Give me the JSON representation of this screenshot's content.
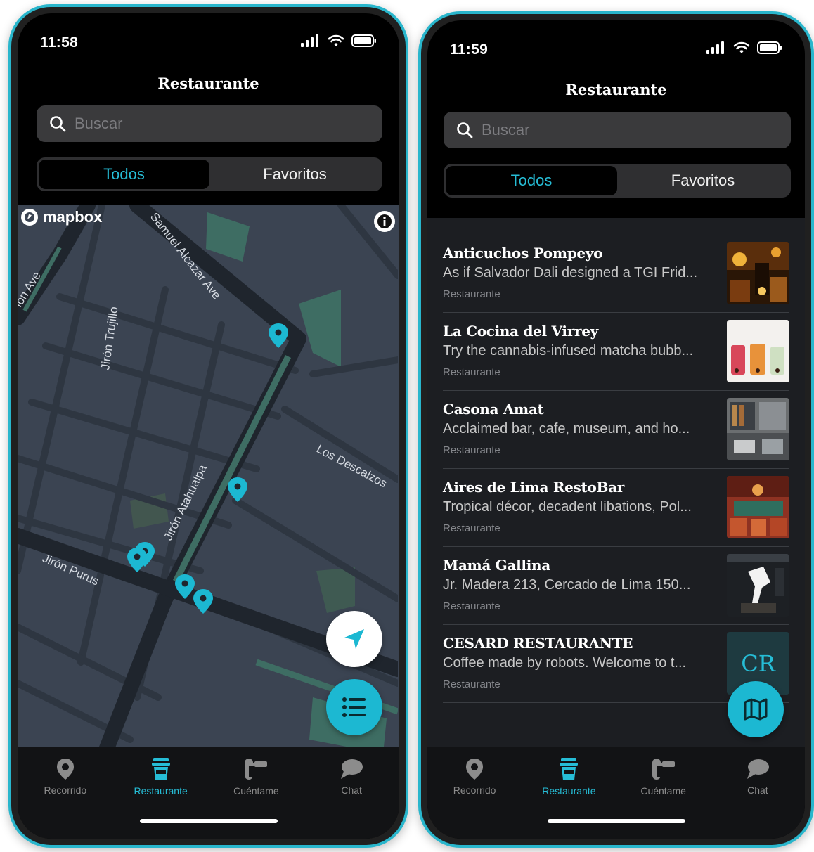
{
  "accent_color": "#26bdd6",
  "screen1": {
    "status": {
      "time": "11:58"
    },
    "title": "Restaurante",
    "search": {
      "placeholder": "Buscar",
      "icon": "search-icon"
    },
    "segments": {
      "all": "Todos",
      "favorites": "Favoritos"
    },
    "map": {
      "logo": "mapbox",
      "streets": [
        "Samuel Alcazar Ave",
        "Jirón Trujillo",
        "Jirón Atahualpa",
        "Los Descalzos",
        "Jirón Purus",
        "ion Ave"
      ]
    }
  },
  "screen2": {
    "status": {
      "time": "11:59"
    },
    "title": "Restaurante",
    "search": {
      "placeholder": "Buscar",
      "icon": "search-icon"
    },
    "segments": {
      "all": "Todos",
      "favorites": "Favoritos"
    },
    "list": [
      {
        "name": "Anticuchos Pompeyo",
        "desc": "As if Salvador Dali designed a TGI Frid...",
        "category": "Restaurante"
      },
      {
        "name": "La Cocina del Virrey",
        "desc": "Try the cannabis-infused matcha bubb...",
        "category": "Restaurante"
      },
      {
        "name": "Casona Amat",
        "desc": "Acclaimed bar, cafe, museum, and ho...",
        "category": "Restaurante"
      },
      {
        "name": "Aires de Lima RestoBar",
        "desc": "Tropical décor, decadent libations, Pol...",
        "category": "Restaurante"
      },
      {
        "name": "Mamá Gallina",
        "desc": "Jr. Madera 213, Cercado de Lima 150...",
        "category": "Restaurante"
      },
      {
        "name": "CESARD RESTAURANTE",
        "desc": "Coffee made by robots. Welcome to t...",
        "category": "Restaurante",
        "thumb_text": "CR"
      }
    ]
  },
  "tabbar": [
    {
      "label": "Recorrido",
      "icon": "location-pin-icon"
    },
    {
      "label": "Restaurante",
      "icon": "coffee-cup-icon"
    },
    {
      "label": "Cuéntame",
      "icon": "audio-guide-icon"
    },
    {
      "label": "Chat",
      "icon": "chat-bubble-icon"
    }
  ]
}
